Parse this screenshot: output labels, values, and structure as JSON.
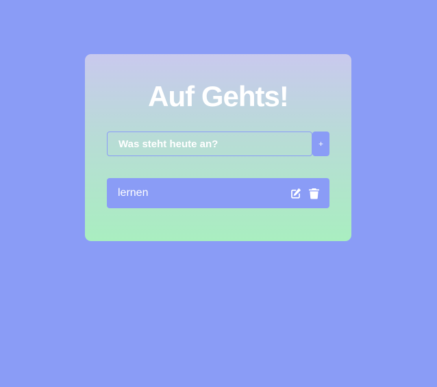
{
  "app": {
    "title": "Auf Gehts!"
  },
  "input": {
    "value": "",
    "placeholder": "Was steht heute an?"
  },
  "add_button": {
    "label": "+"
  },
  "todos": [
    {
      "text": "lernen",
      "edit_icon": "edit-icon",
      "delete_icon": "trash-icon"
    }
  ],
  "colors": {
    "background": "#8a9cf6",
    "card_top": "#c9c9ee",
    "card_bottom": "#a9eec0",
    "accent": "#8a9cf6",
    "text": "#ffffff"
  }
}
